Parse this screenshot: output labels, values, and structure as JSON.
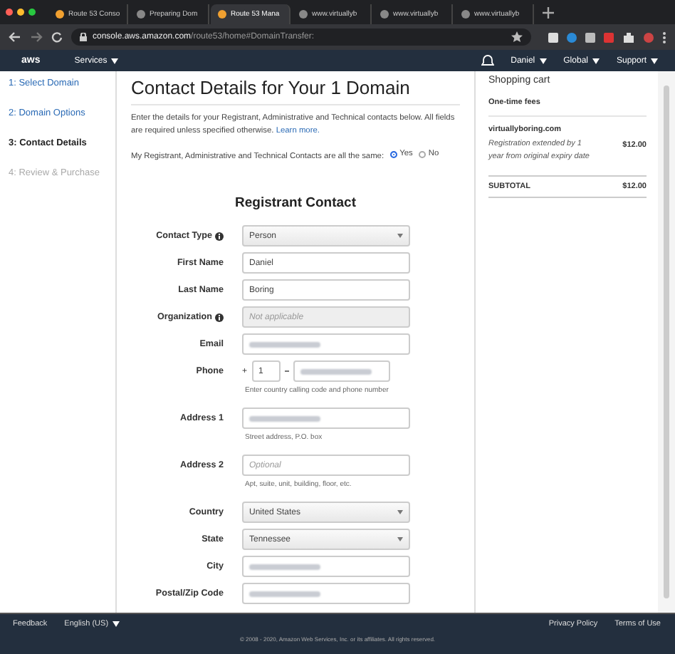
{
  "browser": {
    "tabs": [
      {
        "title": "Route 53 Conso",
        "selected": false
      },
      {
        "title": "Preparing Dom",
        "selected": false
      },
      {
        "title": "Route 53 Mana",
        "selected": true
      },
      {
        "title": "www.virtuallyb",
        "selected": false
      },
      {
        "title": "www.virtuallyb",
        "selected": false
      },
      {
        "title": "www.virtuallyb",
        "selected": false
      }
    ],
    "url_host": "console.aws.amazon.com",
    "url_path": "/route53/home#DomainTransfer:"
  },
  "nav": {
    "logo": "aws",
    "services": "Services",
    "user": "Daniel",
    "region": "Global",
    "support": "Support"
  },
  "steps": [
    {
      "label": "1: Select Domain",
      "selected": false,
      "disabled": false
    },
    {
      "label": "2: Domain Options",
      "selected": false,
      "disabled": false
    },
    {
      "label": "3: Contact Details",
      "selected": true,
      "disabled": false
    },
    {
      "label": "4: Review & Purchase",
      "selected": false,
      "disabled": true
    }
  ],
  "title": "Contact Details for Your 1 Domain",
  "intro": "Enter the details for your Registrant, Administrative and Technical contacts below. All fields are required unless specified otherwise.",
  "learn_more": "Learn more.",
  "same_question": "My Registrant, Administrative and Technical Contacts are all the same:",
  "same_options": [
    {
      "label": "Yes",
      "selected": true
    },
    {
      "label": "No",
      "selected": false
    }
  ],
  "section_title": "Registrant Contact",
  "fields": [
    {
      "label": "Contact Type",
      "kind": "select",
      "value": "Person",
      "info": true
    },
    {
      "label": "First Name",
      "kind": "text",
      "value": "Daniel"
    },
    {
      "label": "Last Name",
      "kind": "text",
      "value": "Boring"
    },
    {
      "label": "Organization",
      "kind": "text",
      "placeholder": "Not applicable",
      "disabled": true,
      "info": true
    },
    {
      "label": "Email",
      "kind": "blurred"
    },
    {
      "label": "Phone",
      "kind": "phone",
      "prefix": "+",
      "code": "1",
      "hint": "Enter country calling code and phone number"
    },
    {
      "label": "Address 1",
      "kind": "blurred",
      "hint": "Street address, P.O. box"
    },
    {
      "label": "Address 2",
      "kind": "text",
      "placeholder": "Optional",
      "hint": "Apt, suite, unit, building, floor, etc."
    },
    {
      "label": "Country",
      "kind": "select",
      "value": "United States"
    },
    {
      "label": "State",
      "kind": "select",
      "value": "Tennessee"
    },
    {
      "label": "City",
      "kind": "blurred"
    },
    {
      "label": "Postal/Zip Code",
      "kind": "blurred"
    }
  ],
  "cart": {
    "title": "Shopping cart",
    "section": "One-time fees",
    "item": "virtuallyboring.com",
    "description": "Registration extended by 1 year from original expiry date",
    "price": "$12.00",
    "subtotal_label": "SUBTOTAL",
    "subtotal": "$12.00"
  },
  "footer": {
    "feedback": "Feedback",
    "language": "English (US)",
    "privacy": "Privacy Policy",
    "terms": "Terms of Use",
    "copyright": "© 2008 - 2020, Amazon Web Services, Inc. or its affiliates. All rights reserved."
  }
}
